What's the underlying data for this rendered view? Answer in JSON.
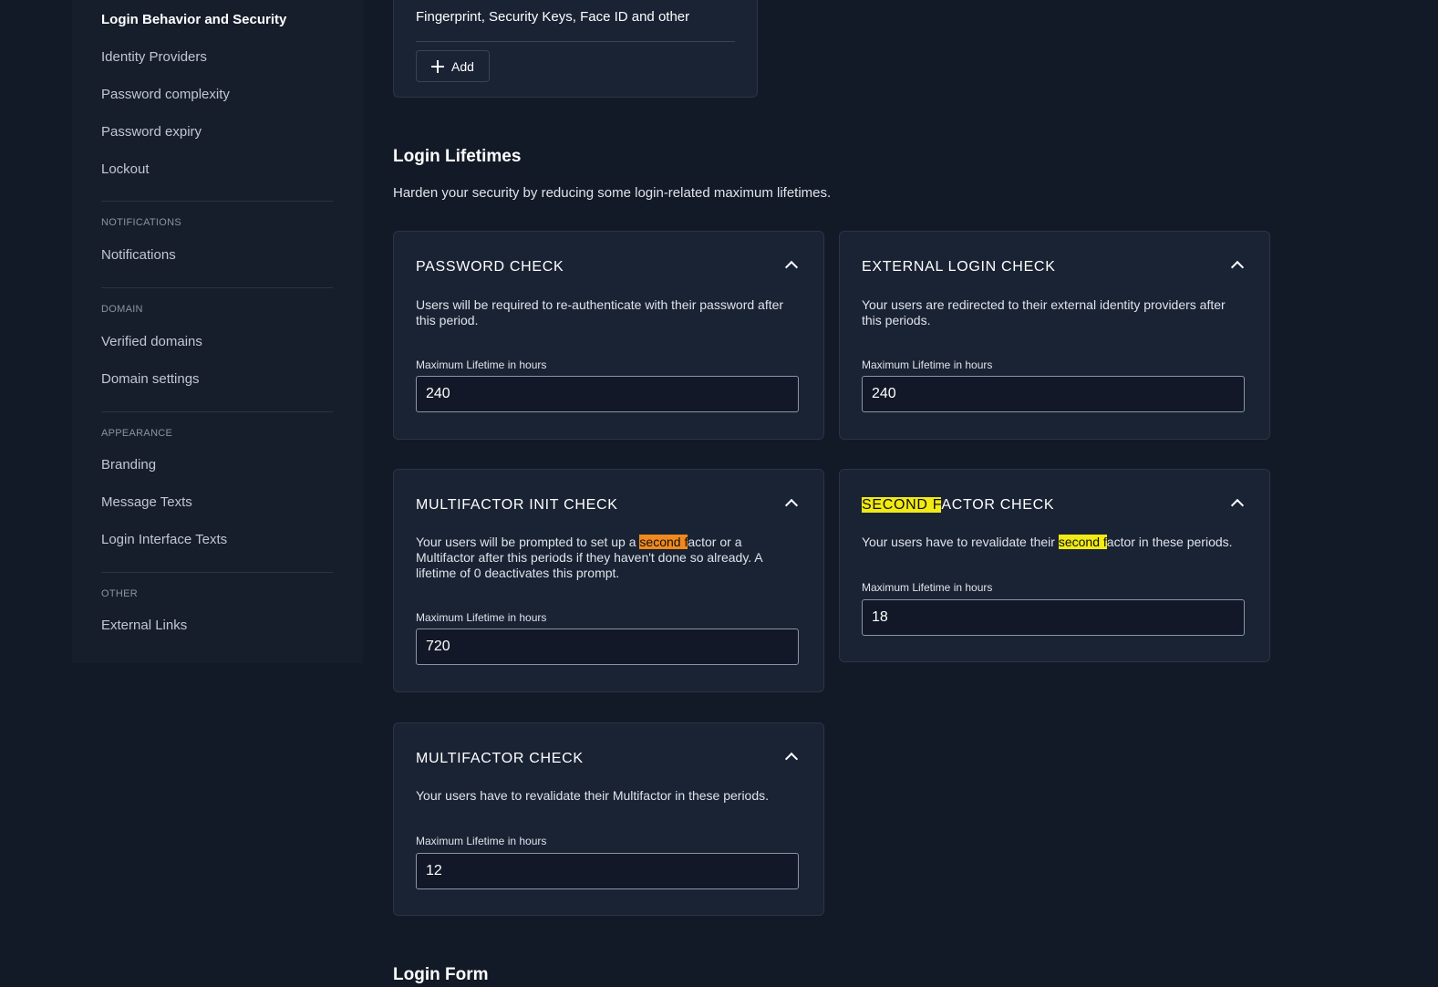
{
  "sidebar": {
    "active_item": "Login Behavior and Security",
    "items_top": [
      "Identity Providers",
      "Password complexity",
      "Password expiry",
      "Lockout"
    ],
    "groups": [
      {
        "heading": "NOTIFICATIONS",
        "items": [
          "Notifications"
        ]
      },
      {
        "heading": "DOMAIN",
        "items": [
          "Verified domains",
          "Domain settings"
        ]
      },
      {
        "heading": "APPEARANCE",
        "items": [
          "Branding",
          "Message Texts",
          "Login Interface Texts"
        ]
      },
      {
        "heading": "OTHER",
        "items": [
          "External Links"
        ]
      }
    ]
  },
  "passwordless": {
    "description": "Fingerprint, Security Keys, Face ID and other",
    "add_label": "Add"
  },
  "lifetimes": {
    "title": "Login Lifetimes",
    "description": "Harden your security by reducing some login-related maximum lifetimes.",
    "field_label": "Maximum Lifetime in hours",
    "cards": {
      "password_check": {
        "title": "PASSWORD CHECK",
        "description": "Users will be required to re-authenticate with their password after this period.",
        "value": "240"
      },
      "external_login_check": {
        "title": "EXTERNAL LOGIN CHECK",
        "description": "Your users are redirected to their external identity providers after this periods.",
        "value": "240"
      },
      "multifactor_init_check": {
        "title": "MULTIFACTOR INIT CHECK",
        "desc_before": "Your users will be prompted to set up a ",
        "desc_highlight": "second f",
        "desc_after": "actor or a Multifactor after this periods if they haven't done so already. A lifetime of 0 deactivates this prompt.",
        "value": "720"
      },
      "second_factor_check": {
        "title_highlight": "SECOND F",
        "title_rest": "ACTOR CHECK",
        "desc_before": "Your users have to revalidate their ",
        "desc_highlight": "second f",
        "desc_after": "actor in these periods.",
        "value": "18"
      },
      "multifactor_check": {
        "title": "MULTIFACTOR CHECK",
        "description": "Your users have to revalidate their Multifactor in these periods.",
        "value": "12"
      }
    }
  },
  "login_form": {
    "title": "Login Form"
  },
  "colors": {
    "background": "#131a27",
    "card": "#1a2334",
    "highlight_current": "#f08a1f",
    "highlight_match": "#f1ea16"
  }
}
